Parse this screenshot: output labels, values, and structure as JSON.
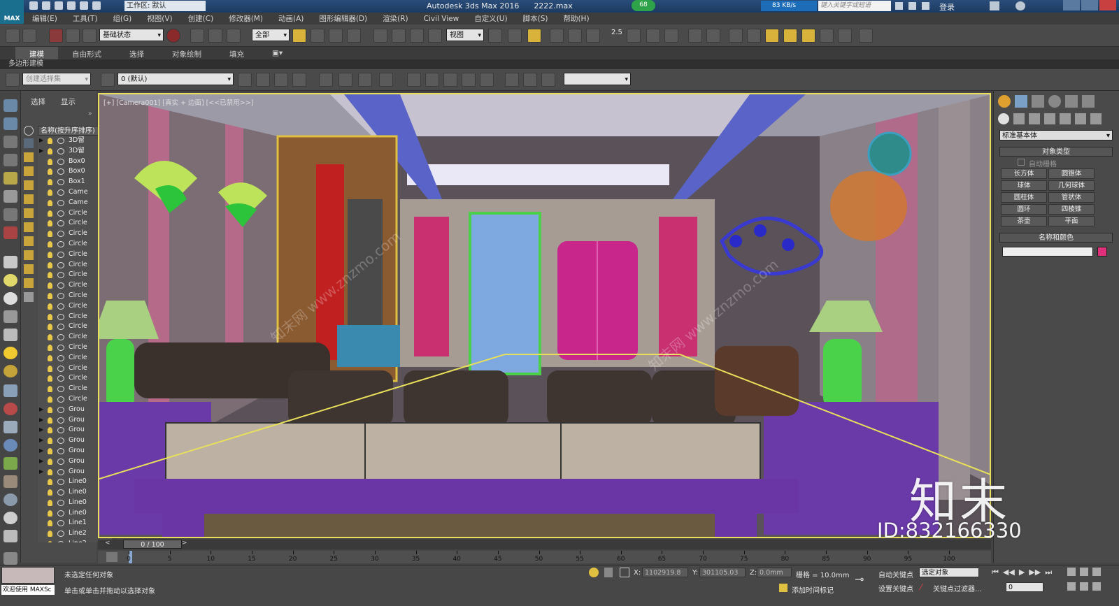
{
  "titlebar": {
    "logo": "MAX",
    "workspace": "工作区: 默认",
    "app_title": "Autodesk 3ds Max 2016",
    "file_name": "2222.max",
    "badge": "68",
    "net_speed": "83 KB/s",
    "search_placeholder": "键入关键字或短语",
    "login": "登录"
  },
  "menu": [
    "编辑(E)",
    "工具(T)",
    "组(G)",
    "视图(V)",
    "创建(C)",
    "修改器(M)",
    "动画(A)",
    "图形编辑器(D)",
    "渲染(R)",
    "Civil View",
    "自定义(U)",
    "脚本(S)",
    "帮助(H)"
  ],
  "toolbar": {
    "selection_set": "基础状态",
    "filter": "全部",
    "ref_coord": "视图",
    "snap_value": "2.5"
  },
  "ribbon": {
    "tabs": [
      "建模",
      "自由形式",
      "选择",
      "对象绘制",
      "填充"
    ],
    "active": "建模",
    "sub": "多边形建模"
  },
  "toolbar2": {
    "named_sel": "创建选择集",
    "layer": "0 (默认)"
  },
  "explorer": {
    "tabs": [
      "选择",
      "显示"
    ],
    "header": "名称(按升序排序)",
    "items": [
      "3D留",
      "3D留",
      "Box0",
      "Box0",
      "Box1",
      "Came",
      "Came",
      "Circle",
      "Circle",
      "Circle",
      "Circle",
      "Circle",
      "Circle",
      "Circle",
      "Circle",
      "Circle",
      "Circle",
      "Circle",
      "Circle",
      "Circle",
      "Circle",
      "Circle",
      "Circle",
      "Circle",
      "Circle",
      "Circle",
      "Grou",
      "Grou",
      "Grou",
      "Grou",
      "Grou",
      "Grou",
      "Grou",
      "Line0",
      "Line0",
      "Line0",
      "Line0",
      "Line1",
      "Line2",
      "Line2"
    ],
    "frames": "0 / 100"
  },
  "viewport": {
    "label": "[+] [Camera001] [真实 + 边面] [<<已禁用>>]"
  },
  "command_panel": {
    "category": "标准基本体",
    "object_type_title": "对象类型",
    "autogrid": "自动栅格",
    "buttons": [
      "长方体",
      "圆锥体",
      "球体",
      "几何球体",
      "圆柱体",
      "管状体",
      "圆环",
      "四棱锥",
      "茶壶",
      "平面"
    ],
    "name_color_title": "名称和颜色",
    "object_color": "#e0307a"
  },
  "timeline": {
    "ticks": [
      0,
      5,
      10,
      15,
      20,
      25,
      30,
      35,
      40,
      45,
      50,
      55,
      60,
      65,
      70,
      75,
      80,
      85,
      90,
      95,
      100
    ]
  },
  "status": {
    "welcome": "欢迎使用 MAXSc",
    "message1": "未选定任何对象",
    "message2": "单击或单击并拖动以选择对象",
    "x_label": "X:",
    "x_value": "1102919.8",
    "y_label": "Y:",
    "y_value": "301105.03",
    "z_label": "Z:",
    "z_value": "0.0mm",
    "grid": "栅格 = 10.0mm",
    "add_time_tag": "添加时间标记",
    "auto_key": "自动关键点",
    "set_key": "设置关键点",
    "selected_object": "选定对象",
    "key_filters": "关键点过滤器...",
    "frame": "0"
  },
  "watermark": {
    "logo": "知末",
    "id": "ID:832166330",
    "diag": "知末网 www.znzmo.com"
  },
  "colors": {
    "viewport_border": "#e8e05a",
    "ui_dark": "#4a4a4a"
  }
}
